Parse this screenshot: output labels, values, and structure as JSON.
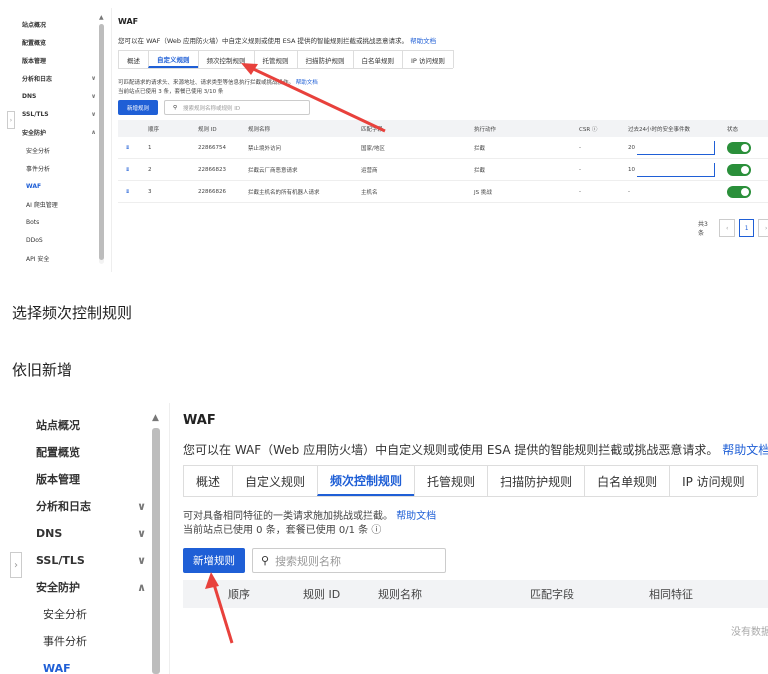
{
  "screenshot1": {
    "sidebar": {
      "items": [
        {
          "label": "站点概况",
          "chev": ""
        },
        {
          "label": "配置概览",
          "chev": ""
        },
        {
          "label": "版本管理",
          "chev": ""
        },
        {
          "label": "分析和日志",
          "chev": "∨"
        },
        {
          "label": "DNS",
          "chev": "∨"
        },
        {
          "label": "SSL/TLS",
          "chev": "∨"
        },
        {
          "label": "安全防护",
          "chev": "∧"
        },
        {
          "label": "安全分析",
          "chev": ""
        },
        {
          "label": "事件分析",
          "chev": ""
        },
        {
          "label": "WAF",
          "chev": ""
        },
        {
          "label": "AI 爬虫管理",
          "chev": ""
        },
        {
          "label": "Bots",
          "chev": ""
        },
        {
          "label": "DDoS",
          "chev": ""
        },
        {
          "label": "API 安全",
          "chev": ""
        }
      ]
    },
    "title": "WAF",
    "intro_text": "您可以在 WAF（Web 应用防火墙）中自定义规则或使用 ESA 提供的智能规则拦截或挑战恶意请求。",
    "help_link": "帮助文档",
    "tabs": [
      "概述",
      "自定义规则",
      "频次控制规则",
      "托管规则",
      "扫描防护规则",
      "白名单规则",
      "IP 访问规则"
    ],
    "active_tab": 1,
    "note_line1": "可匹配请求的请求头、来源地址、请求类型等信息执行拦截或挑战操作。",
    "note_help": "帮助文档",
    "note_line2": "当前站点已使用 3 条，套餐已使用 3/10 条",
    "add_button": "新增规则",
    "search_placeholder": "搜索规则名称或规则 ID",
    "columns": [
      "顺序",
      "规则 ID",
      "规则名称",
      "匹配字段",
      "执行动作",
      "CSR ⓘ",
      "过去24小时的安全事件数",
      "状态"
    ],
    "rows": [
      {
        "order": "1",
        "id": "22866754",
        "name": "禁止境外访问",
        "field": "国家/地区",
        "action": "拦截",
        "csr": "-",
        "events": "20"
      },
      {
        "order": "2",
        "id": "22866823",
        "name": "拦截云厂商恶意请求",
        "field": "运营商",
        "action": "拦截",
        "csr": "-",
        "events": "10"
      },
      {
        "order": "3",
        "id": "22866826",
        "name": "拦截主机名的所有机器人请求",
        "field": "主机名",
        "action": "JS 挑战",
        "csr": "-",
        "events": "-"
      }
    ],
    "pager_total": "共3条",
    "pager_page": "1"
  },
  "caption1": "选择频次控制规则",
  "caption2": "依旧新增",
  "screenshot2": {
    "sidebar": {
      "items": [
        {
          "label": "站点概况",
          "chev": ""
        },
        {
          "label": "配置概览",
          "chev": ""
        },
        {
          "label": "版本管理",
          "chev": ""
        },
        {
          "label": "分析和日志",
          "chev": "∨"
        },
        {
          "label": "DNS",
          "chev": "∨"
        },
        {
          "label": "SSL/TLS",
          "chev": "∨"
        },
        {
          "label": "安全防护",
          "chev": "∧"
        },
        {
          "label": "安全分析",
          "chev": ""
        },
        {
          "label": "事件分析",
          "chev": ""
        },
        {
          "label": "WAF",
          "chev": ""
        }
      ]
    },
    "title": "WAF",
    "intro_text": "您可以在 WAF（Web 应用防火墙）中自定义规则或使用 ESA 提供的智能规则拦截或挑战恶意请求。",
    "help_link": "帮助文档",
    "tabs": [
      "概述",
      "自定义规则",
      "频次控制规则",
      "托管规则",
      "扫描防护规则",
      "白名单规则",
      "IP 访问规则"
    ],
    "active_tab": 2,
    "note_line1": "可对具备相同特征的一类请求施加挑战或拦截。",
    "note_help": "帮助文档",
    "note_line2": "当前站点已使用 0 条，套餐已使用 0/1 条 ⓘ",
    "add_button": "新增规则",
    "search_placeholder": "搜索规则名称",
    "columns": [
      "顺序",
      "规则 ID",
      "规则名称",
      "匹配字段",
      "相同特征"
    ],
    "empty_text": "没有数据"
  },
  "colors": {
    "accent": "#1f5fd6",
    "arrow": "#e8413c",
    "toggle_on": "#2a8f3a"
  }
}
